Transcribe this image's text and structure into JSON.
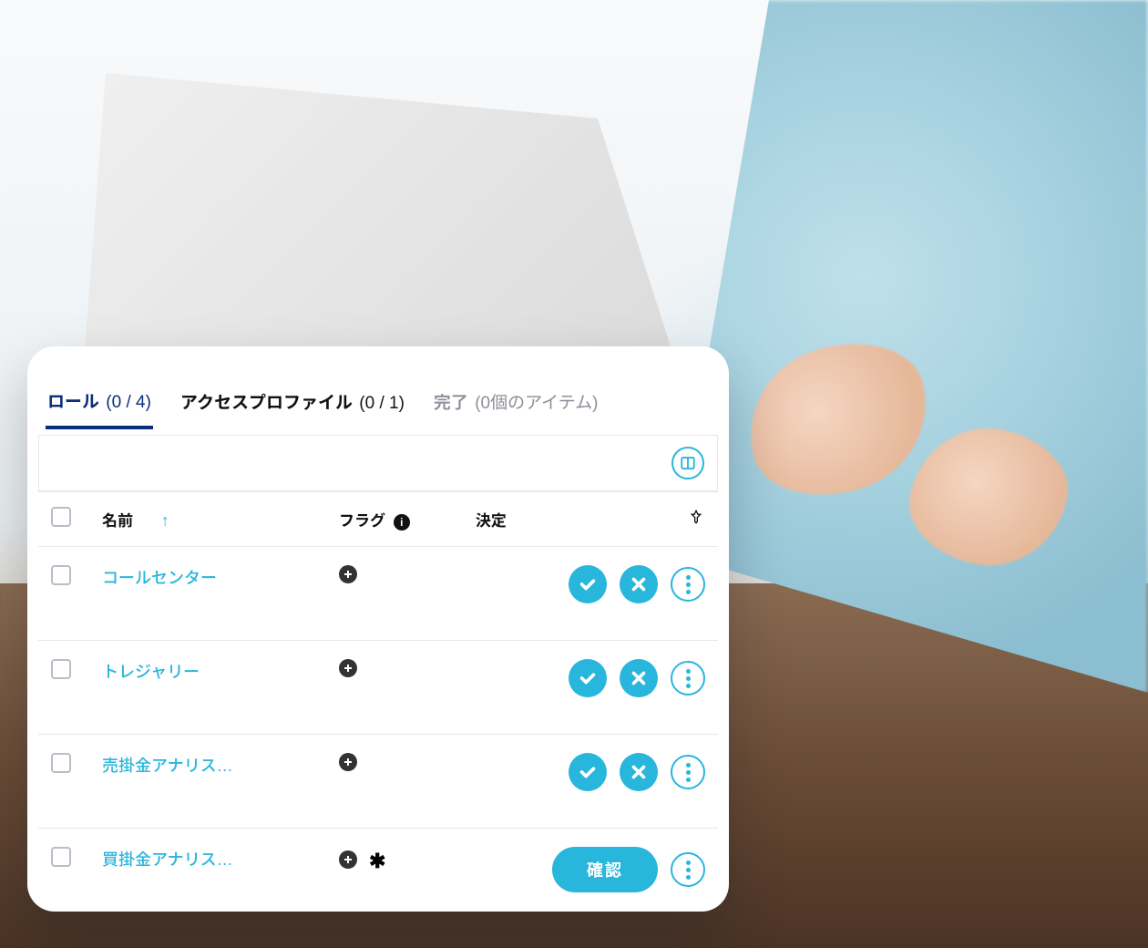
{
  "tabs": [
    {
      "label": "ロール",
      "count": "(0 / 4)",
      "active": true
    },
    {
      "label": "アクセスプロファイル",
      "count": "(0 / 1)",
      "active": false
    },
    {
      "label": "完了",
      "count": "(0個のアイテム)",
      "active": false
    }
  ],
  "columns": {
    "name": "名前",
    "flag": "フラグ",
    "decision": "決定"
  },
  "rows": [
    {
      "name": "コールセンター",
      "decision_mode": "approve_reject"
    },
    {
      "name": "トレジャリー",
      "decision_mode": "approve_reject"
    },
    {
      "name": "売掛金アナリス…",
      "decision_mode": "approve_reject"
    },
    {
      "name": "買掛金アナリス…",
      "decision_mode": "confirm",
      "flag_mark": "✱"
    }
  ],
  "actions": {
    "confirm": "確認"
  },
  "colors": {
    "accent": "#29b6dc",
    "tab_active": "#0a2e7a"
  }
}
